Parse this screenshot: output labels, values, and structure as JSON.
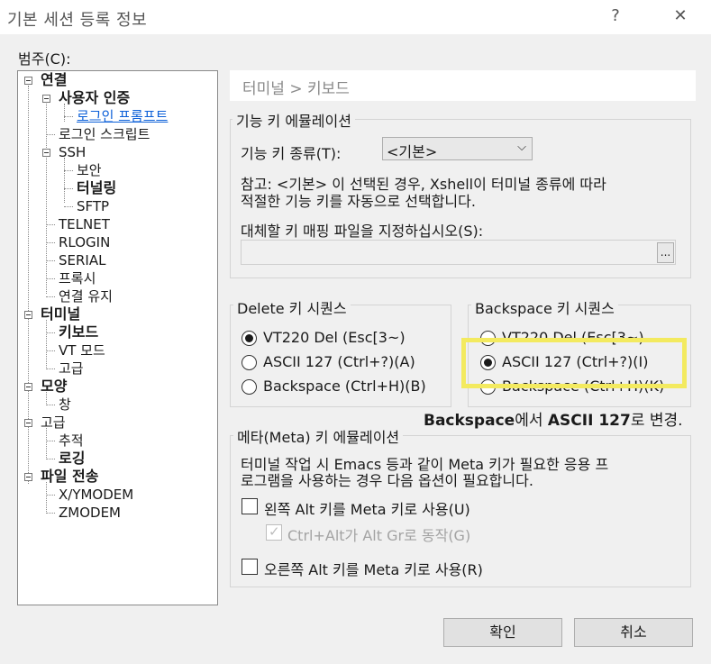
{
  "window": {
    "title": "기본 세션 등록 정보",
    "help": "?",
    "close": "✕"
  },
  "category_label": "범주(C):",
  "tree": [
    {
      "label": "연결",
      "bold": true
    },
    {
      "label": "사용자 인증",
      "bold": true
    },
    {
      "label": "로그인 프롬프트",
      "link": true
    },
    {
      "label": "로그인 스크립트"
    },
    {
      "label": "SSH"
    },
    {
      "label": "보안"
    },
    {
      "label": "터널링",
      "bold": true
    },
    {
      "label": "SFTP"
    },
    {
      "label": "TELNET"
    },
    {
      "label": "RLOGIN"
    },
    {
      "label": "SERIAL"
    },
    {
      "label": "프록시"
    },
    {
      "label": "연결 유지"
    },
    {
      "label": "터미널",
      "bold": true
    },
    {
      "label": "키보드",
      "bold": true
    },
    {
      "label": "VT 모드"
    },
    {
      "label": "고급"
    },
    {
      "label": "모양",
      "bold": true
    },
    {
      "label": "창"
    },
    {
      "label": "고급"
    },
    {
      "label": "추적"
    },
    {
      "label": "로깅",
      "bold": true
    },
    {
      "label": "파일 전송",
      "bold": true
    },
    {
      "label": "X/YMODEM"
    },
    {
      "label": "ZMODEM"
    }
  ],
  "breadcrumb": "터미널 > 키보드",
  "function_key": {
    "group_title": "기능 키 에뮬레이션",
    "type_label": "기능 키 종류(T):",
    "type_value": "<기본>",
    "note_line1": "참고: <기본> 이 선택된 경우, Xshell이 터미널 종류에 따라",
    "note_line2": "적절한 기능 키를 자동으로 선택합니다.",
    "keymap_label": "대체할 키 매핑 파일을 지정하십시오(S):",
    "keymap_value": "",
    "browse_label": "..."
  },
  "delete_seq": {
    "title": "Delete 키 시퀀스",
    "options": [
      {
        "label": "VT220 Del (Esc[3~)",
        "checked": true
      },
      {
        "label": "ASCII 127 (Ctrl+?)(A)",
        "checked": false
      },
      {
        "label": "Backspace (Ctrl+H)(B)",
        "checked": false
      }
    ]
  },
  "backspace_seq": {
    "title": "Backspace 키 시퀀스",
    "options": [
      {
        "label": "VT220 Del (Esc[3~)",
        "checked": false
      },
      {
        "label": "ASCII 127 (Ctrl+?)(I)",
        "checked": true
      },
      {
        "label": "Backspace (Ctrl+H)(K)",
        "checked": false
      }
    ]
  },
  "annotation": {
    "b1": "Backspace",
    "t1": "에서 ",
    "b2": "ASCII 127",
    "t2": "로 변경."
  },
  "meta": {
    "title": "메타(Meta) 키 에뮬레이션",
    "desc_line1": "터미널 작업 시 Emacs 등과 같이 Meta 키가 필요한 응용 프",
    "desc_line2": "로그램을 사용하는 경우 다음 옵션이 필요합니다.",
    "left_alt": "왼쪽 Alt 키를 Meta 키로 사용(U)",
    "altgr": "Ctrl+Alt가 Alt Gr로 동작(G)",
    "right_alt": "오른쪽 Alt 키를 Meta 키로 사용(R)"
  },
  "buttons": {
    "ok": "확인",
    "cancel": "취소"
  },
  "colors": {
    "highlight": "#f3ea5f",
    "link": "#0b5fd8"
  }
}
